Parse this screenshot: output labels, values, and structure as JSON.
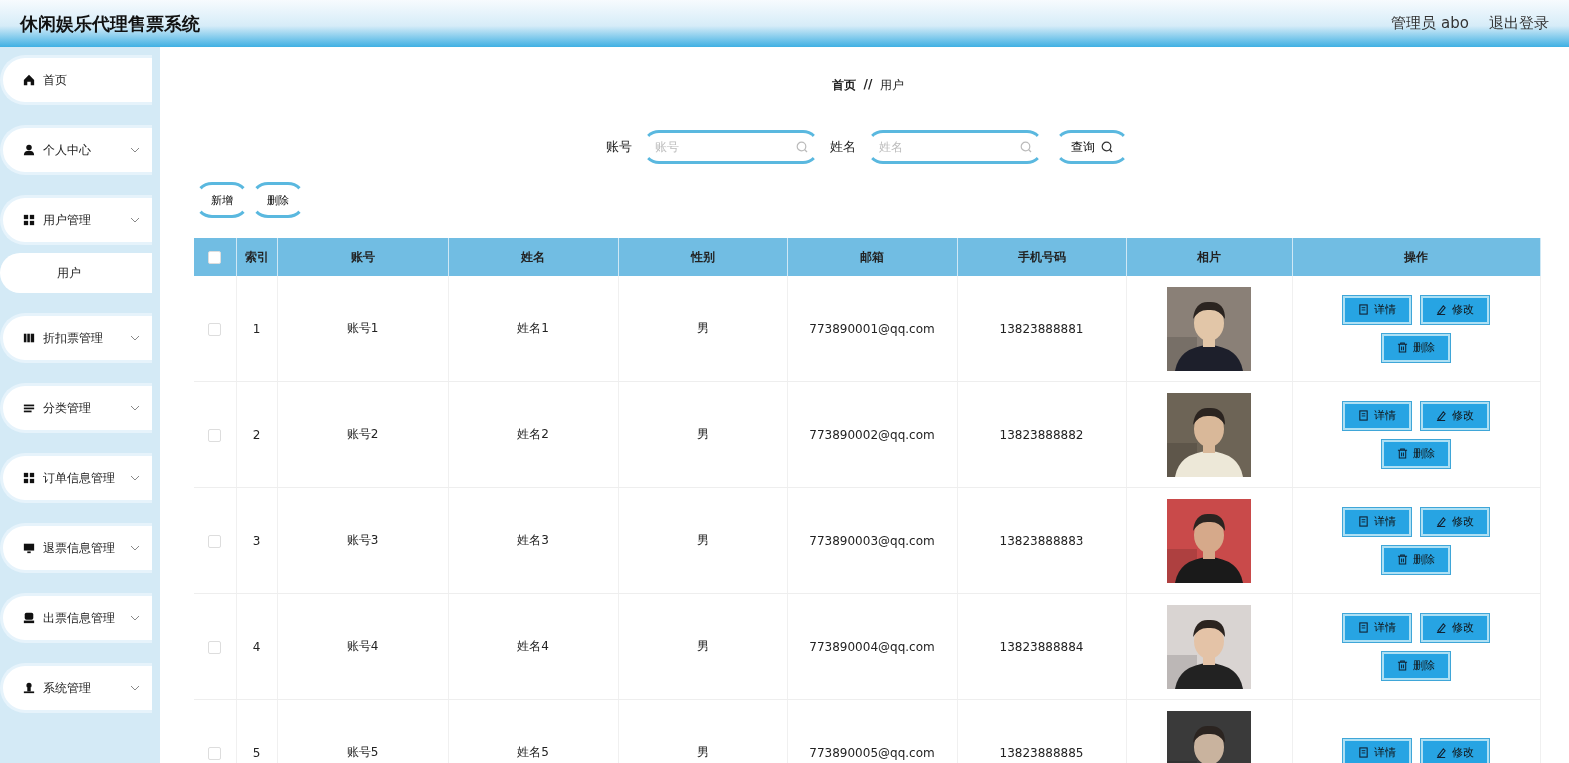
{
  "header": {
    "title": "休闲娱乐代理售票系统",
    "user": "管理员 abo",
    "logout": "退出登录"
  },
  "sidebar": {
    "items": [
      {
        "kind": "link",
        "label": "首页"
      },
      {
        "kind": "menu",
        "label": "个人中心"
      },
      {
        "kind": "menu",
        "label": "用户管理",
        "children": [
          {
            "label": "用户"
          }
        ]
      },
      {
        "kind": "menu",
        "label": "折扣票管理"
      },
      {
        "kind": "menu",
        "label": "分类管理"
      },
      {
        "kind": "menu",
        "label": "订单信息管理"
      },
      {
        "kind": "menu",
        "label": "退票信息管理"
      },
      {
        "kind": "menu",
        "label": "出票信息管理"
      },
      {
        "kind": "menu",
        "label": "系统管理"
      }
    ]
  },
  "breadcrumb": [
    "首页",
    "//",
    "用户"
  ],
  "search": {
    "fields": [
      {
        "label": "账号",
        "placeholder": "账号"
      },
      {
        "label": "姓名",
        "placeholder": "姓名"
      }
    ],
    "button": "查询"
  },
  "toolbar": [
    "新增",
    "删除"
  ],
  "table": {
    "select_all": false,
    "columns": [
      "索引",
      "账号",
      "姓名",
      "性别",
      "邮箱",
      "手机号码",
      "相片",
      "操作"
    ],
    "rows": [
      {
        "checked": false,
        "cells": [
          "1",
          "账号1",
          "姓名1",
          "男",
          "773890001@qq.com",
          "13823888881"
        ],
        "photo": {
          "kind": "picture"
        },
        "actions": [
          "详情",
          "修改",
          "删除"
        ]
      },
      {
        "checked": false,
        "cells": [
          "2",
          "账号2",
          "姓名2",
          "男",
          "773890002@qq.com",
          "13823888882"
        ],
        "photo": {
          "kind": "picture"
        },
        "actions": [
          "详情",
          "修改",
          "删除"
        ]
      },
      {
        "checked": false,
        "cells": [
          "3",
          "账号3",
          "姓名3",
          "男",
          "773890003@qq.com",
          "13823888883"
        ],
        "photo": {
          "kind": "picture"
        },
        "actions": [
          "详情",
          "修改",
          "删除"
        ]
      },
      {
        "checked": false,
        "cells": [
          "4",
          "账号4",
          "姓名4",
          "男",
          "773890004@qq.com",
          "13823888884"
        ],
        "photo": {
          "kind": "picture"
        },
        "actions": [
          "详情",
          "修改",
          "删除"
        ]
      },
      {
        "checked": false,
        "cells": [
          "5",
          "账号5",
          "姓名5",
          "男",
          "773890005@qq.com",
          "13823888885"
        ],
        "photo": {
          "kind": "picture"
        },
        "actions": [
          "详情",
          "修改"
        ]
      }
    ]
  }
}
